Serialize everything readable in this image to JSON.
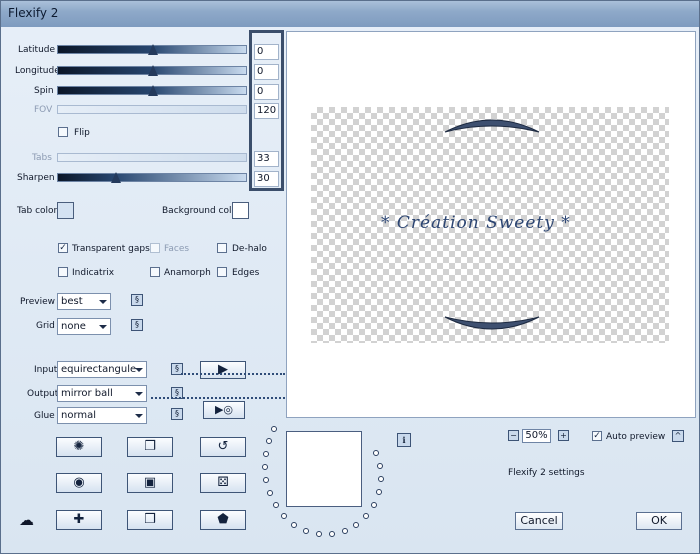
{
  "window": {
    "title": "Flexify 2"
  },
  "sliders": [
    {
      "label": "Latitude",
      "value": "0",
      "level": 0.5,
      "enabled": true
    },
    {
      "label": "Longitude",
      "value": "0",
      "level": 0.5,
      "enabled": true
    },
    {
      "label": "Spin",
      "value": "0",
      "level": 0.5,
      "enabled": true
    },
    {
      "label": "FOV",
      "value": "120",
      "level": 0.67,
      "enabled": false
    },
    {
      "label": "Tabs",
      "value": "33",
      "level": 0.33,
      "enabled": false
    },
    {
      "label": "Sharpen",
      "value": "30",
      "level": 0.3,
      "enabled": true
    }
  ],
  "flip": {
    "label": "Flip",
    "checked": false
  },
  "colors": {
    "tab_color_label": "Tab color",
    "tab_color": "#d4e2f2",
    "background_color_label": "Background color",
    "background_color": "#ffffff"
  },
  "options": {
    "transparent_gaps": {
      "label": "Transparent gaps",
      "checked": true,
      "mark": "✓"
    },
    "faces": {
      "label": "Faces",
      "checked": false
    },
    "de_halo": {
      "label": "De-halo",
      "checked": false
    },
    "indicatrix": {
      "label": "Indicatrix",
      "checked": false
    },
    "anamorph": {
      "label": "Anamorph",
      "checked": false
    },
    "edges": {
      "label": "Edges",
      "checked": false
    }
  },
  "preview": {
    "label": "Preview",
    "value": "best"
  },
  "grid": {
    "label": "Grid",
    "value": "none"
  },
  "input": {
    "label": "Input",
    "value": "equirectangule"
  },
  "output": {
    "label": "Output",
    "value": "mirror ball"
  },
  "glue": {
    "label": "Glue",
    "value": "normal"
  },
  "image": {
    "watermark": "* Création Sweety *"
  },
  "zoom": {
    "value": "50%",
    "minus": "−",
    "plus": "+"
  },
  "auto_preview": {
    "label": "Auto preview",
    "checked": true,
    "mark": "✓"
  },
  "settings_name": "Flexify 2 settings",
  "buttons": {
    "cancel": "Cancel",
    "ok": "OK",
    "info": "i",
    "collapse": "^"
  },
  "icons": {
    "link": "§",
    "tool_buttons": [
      "✺",
      "❐",
      "↺",
      "◉",
      "▣",
      "⚄",
      "☁",
      "✚",
      "❒",
      "⬟"
    ],
    "input_swap": "▶",
    "play_disc": "▶◎"
  }
}
